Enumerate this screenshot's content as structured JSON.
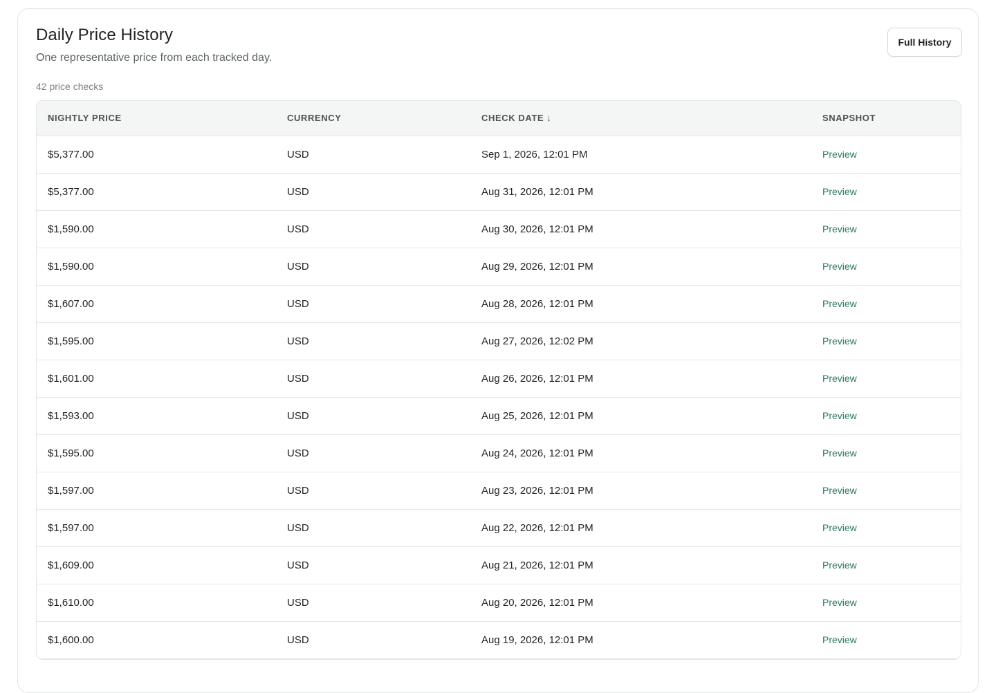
{
  "header": {
    "title": "Daily Price History",
    "subtitle": "One representative price from each tracked day.",
    "count_label": "42 price checks",
    "full_history_button": "Full History"
  },
  "table": {
    "columns": {
      "price": "NIGHTLY PRICE",
      "currency": "CURRENCY",
      "check_date": "CHECK DATE",
      "check_date_sort_icon": "↓",
      "snapshot": "SNAPSHOT"
    },
    "rows": [
      {
        "price": "$5,377.00",
        "currency": "USD",
        "date": "Sep 1, 2026, 12:01 PM",
        "snapshot": "Preview"
      },
      {
        "price": "$5,377.00",
        "currency": "USD",
        "date": "Aug 31, 2026, 12:01 PM",
        "snapshot": "Preview"
      },
      {
        "price": "$1,590.00",
        "currency": "USD",
        "date": "Aug 30, 2026, 12:01 PM",
        "snapshot": "Preview"
      },
      {
        "price": "$1,590.00",
        "currency": "USD",
        "date": "Aug 29, 2026, 12:01 PM",
        "snapshot": "Preview"
      },
      {
        "price": "$1,607.00",
        "currency": "USD",
        "date": "Aug 28, 2026, 12:01 PM",
        "snapshot": "Preview"
      },
      {
        "price": "$1,595.00",
        "currency": "USD",
        "date": "Aug 27, 2026, 12:02 PM",
        "snapshot": "Preview"
      },
      {
        "price": "$1,601.00",
        "currency": "USD",
        "date": "Aug 26, 2026, 12:01 PM",
        "snapshot": "Preview"
      },
      {
        "price": "$1,593.00",
        "currency": "USD",
        "date": "Aug 25, 2026, 12:01 PM",
        "snapshot": "Preview"
      },
      {
        "price": "$1,595.00",
        "currency": "USD",
        "date": "Aug 24, 2026, 12:01 PM",
        "snapshot": "Preview"
      },
      {
        "price": "$1,597.00",
        "currency": "USD",
        "date": "Aug 23, 2026, 12:01 PM",
        "snapshot": "Preview"
      },
      {
        "price": "$1,597.00",
        "currency": "USD",
        "date": "Aug 22, 2026, 12:01 PM",
        "snapshot": "Preview"
      },
      {
        "price": "$1,609.00",
        "currency": "USD",
        "date": "Aug 21, 2026, 12:01 PM",
        "snapshot": "Preview"
      },
      {
        "price": "$1,610.00",
        "currency": "USD",
        "date": "Aug 20, 2026, 12:01 PM",
        "snapshot": "Preview"
      },
      {
        "price": "$1,600.00",
        "currency": "USD",
        "date": "Aug 19, 2026, 12:01 PM",
        "snapshot": "Preview"
      }
    ]
  },
  "colors": {
    "link": "#2b7a5a",
    "header_bg": "#f4f6f5",
    "border": "#e2e5e3"
  }
}
